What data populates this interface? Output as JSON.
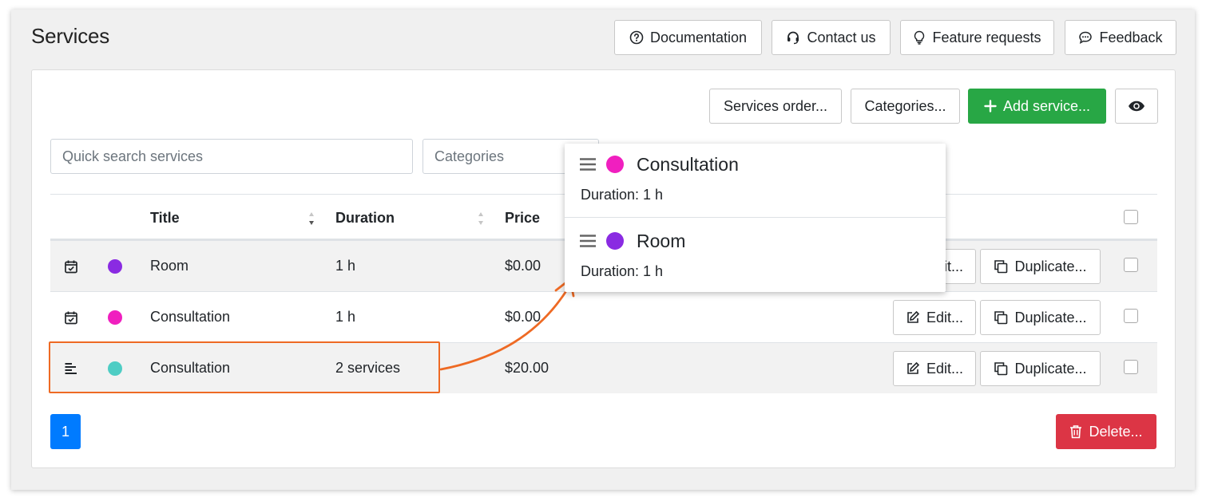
{
  "page": {
    "title": "Services"
  },
  "header_buttons": {
    "documentation": "Documentation",
    "contact": "Contact us",
    "feature_requests": "Feature requests",
    "feedback": "Feedback"
  },
  "toolbar": {
    "services_order": "Services order...",
    "categories": "Categories...",
    "add_service": "Add service..."
  },
  "filters": {
    "search_placeholder": "Quick search services",
    "categories_placeholder": "Categories"
  },
  "table": {
    "columns": {
      "title": "Title",
      "duration": "Duration",
      "price": "Price"
    },
    "edit_label": "Edit...",
    "duplicate_label": "Duplicate...",
    "rows": [
      {
        "type_icon": "calendar-check-icon",
        "color": "#8a2be2",
        "title": "Room",
        "duration": "1 h",
        "price": "$0.00"
      },
      {
        "type_icon": "calendar-check-icon",
        "color": "#f01fbf",
        "title": "Consultation",
        "duration": "1 h",
        "price": "$0.00"
      },
      {
        "type_icon": "compound-list-icon",
        "color": "#4ecdc4",
        "title": "Consultation",
        "duration": "2 services",
        "price": "$20.00"
      }
    ]
  },
  "popup": {
    "items": [
      {
        "color": "#f01fbf",
        "title": "Consultation",
        "duration": "Duration: 1 h"
      },
      {
        "color": "#8a2be2",
        "title": "Room",
        "duration": "Duration: 1 h"
      }
    ]
  },
  "pagination": {
    "current": "1"
  },
  "footer": {
    "delete_label": "Delete..."
  },
  "colors": {
    "accent_annotation": "#ee6a24",
    "success": "#28a745",
    "danger": "#dc3545",
    "primary": "#007bff"
  }
}
